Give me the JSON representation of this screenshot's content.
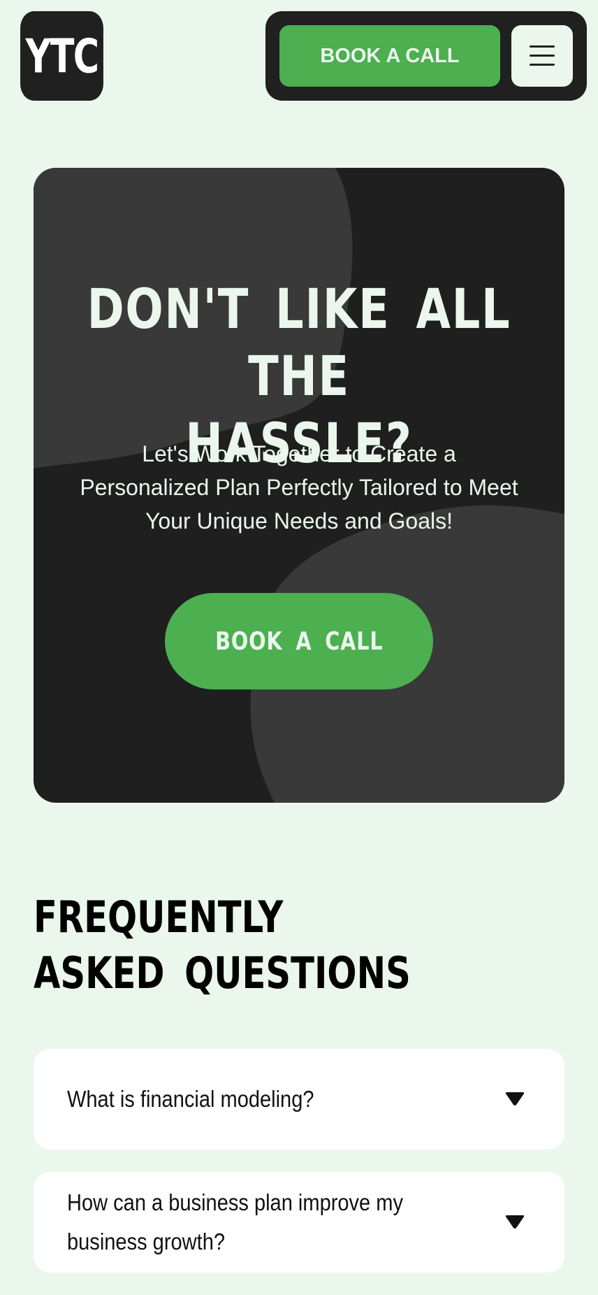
{
  "header": {
    "logo_text": "YTC",
    "book_button_label": "BOOK A CALL",
    "menu_icon": "hamburger-menu-icon"
  },
  "hero": {
    "title_line1": "DON'T LIKE ALL THE",
    "title_line2": "HASSLE?",
    "subtitle_line1": "Let's Work Together to Create a",
    "subtitle_line2": "Personalized Plan Perfectly Tailored to Meet",
    "subtitle_line3": "Your Unique Needs and Goals!",
    "cta_label": "BOOK A CALL"
  },
  "faq": {
    "heading_line1": "FREQUENTLY",
    "heading_line2": "ASKED QUESTIONS",
    "items": [
      {
        "question": "What is financial modeling?",
        "icon": "caret-down-icon"
      },
      {
        "question_line1": "How can a business plan improve my",
        "question_line2": "business growth?",
        "icon": "caret-down-icon"
      }
    ]
  },
  "colors": {
    "page_background": "#ebf7ec",
    "dark": "#1f201f",
    "accent_green": "#4caf50",
    "blob": "#393939"
  }
}
